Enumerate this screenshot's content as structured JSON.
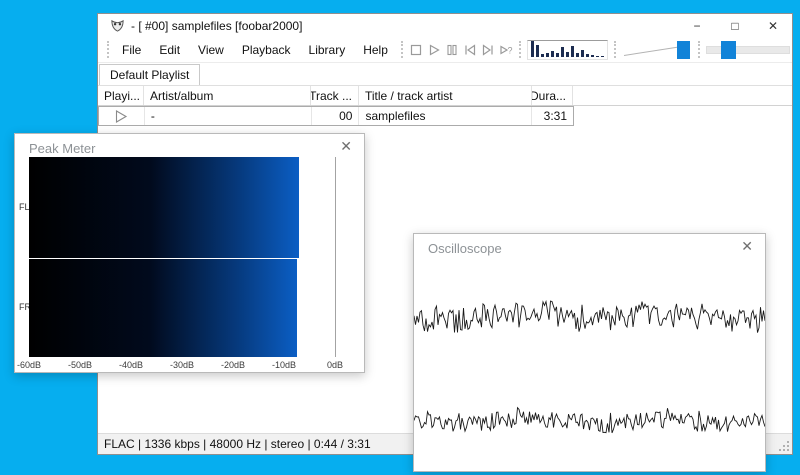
{
  "desktop": {
    "background_color": "#06aeef"
  },
  "main_window": {
    "title": "- [ #00] samplefiles  [foobar2000]",
    "window_controls": {
      "minimize": "−",
      "maximize": "□",
      "close": "✕"
    },
    "menu": [
      "File",
      "Edit",
      "View",
      "Playback",
      "Library",
      "Help"
    ],
    "transport": [
      "stop",
      "play",
      "pause",
      "previous",
      "next",
      "random"
    ],
    "spectrum_bars_pct": [
      100,
      78,
      20,
      25,
      40,
      25,
      62,
      30,
      68,
      28,
      42,
      18,
      12,
      9,
      7
    ],
    "spectrum_color": "#1c2c50",
    "volume": {
      "level_pct": 100
    },
    "seek": {
      "position_pct": 13
    },
    "accent_color": "#1283d8",
    "tab_label": "Default Playlist",
    "playlist": {
      "columns": [
        {
          "label": "Playi..."
        },
        {
          "label": "Artist/album"
        },
        {
          "label": "Track ..."
        },
        {
          "label": "Title / track artist"
        },
        {
          "label": "Dura..."
        }
      ],
      "rows": [
        {
          "playing_icon": "play",
          "artist_album": "-",
          "track": "00",
          "title": "samplefiles",
          "duration": "3:31"
        }
      ]
    },
    "status_bar": "FLAC | 1336 kbps | 48000 Hz | stereo | 0:44 / 3:31"
  },
  "peak_meter": {
    "title": "Peak Meter",
    "close_glyph": "✕",
    "scale_min_db": -60,
    "scale_max_db": 0,
    "scale_labels": [
      "-60dB",
      "-50dB",
      "-40dB",
      "-30dB",
      "-20dB",
      "-10dB",
      "0dB"
    ],
    "channels": [
      {
        "label": "FL",
        "peak_db": -7
      },
      {
        "label": "FR",
        "peak_db": -7.5
      }
    ],
    "gradient": [
      "#000000",
      "#0b5ec4"
    ]
  },
  "oscilloscope": {
    "title": "Oscilloscope",
    "close_glyph": "✕",
    "channels": 2,
    "waveform_color": "#191919"
  }
}
